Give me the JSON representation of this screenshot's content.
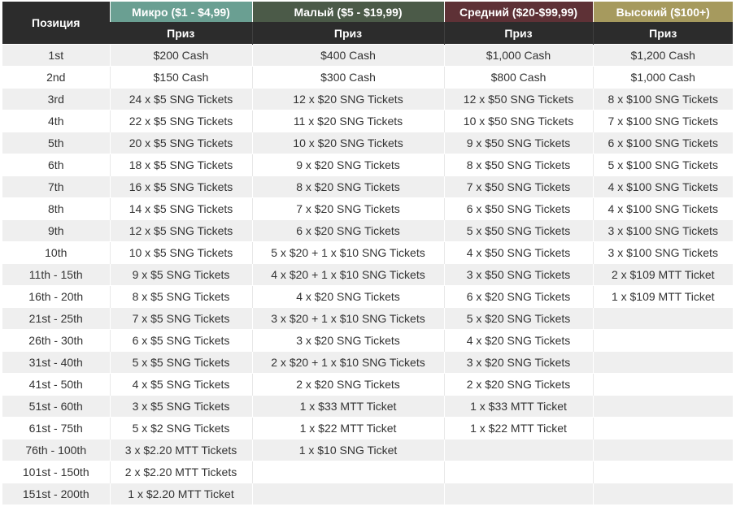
{
  "table": {
    "position_header": "Позиция",
    "prize_label": "Приз",
    "tiers": [
      {
        "label": "Микро ($1 - $4,99)",
        "color": "#6a9f92"
      },
      {
        "label": "Малый ($5 - $19,99)",
        "color": "#4b5a48"
      },
      {
        "label": "Средний ($20-$99,99)",
        "color": "#5e3136"
      },
      {
        "label": "Высокий ($100+)",
        "color": "#a69a5e"
      }
    ],
    "rows": [
      [
        "1st",
        "$200 Cash",
        "$400 Cash",
        "$1,000 Cash",
        "$1,200 Cash"
      ],
      [
        "2nd",
        "$150 Cash",
        "$300 Cash",
        "$800 Cash",
        "$1,000 Cash"
      ],
      [
        "3rd",
        "24 x $5 SNG Tickets",
        "12 x $20 SNG Tickets",
        "12 x $50 SNG Tickets",
        "8 x $100 SNG Tickets"
      ],
      [
        "4th",
        "22 x $5 SNG Tickets",
        "11 x $20 SNG Tickets",
        "10 x $50 SNG Tickets",
        "7 x $100 SNG Tickets"
      ],
      [
        "5th",
        "20 x $5 SNG Tickets",
        "10 x $20 SNG Tickets",
        "9 x $50 SNG Tickets",
        "6 x $100 SNG Tickets"
      ],
      [
        "6th",
        "18 x $5 SNG Tickets",
        "9 x $20 SNG Tickets",
        "8 x $50 SNG Tickets",
        "5 x $100 SNG Tickets"
      ],
      [
        "7th",
        "16 x $5 SNG Tickets",
        "8 x $20 SNG Tickets",
        "7 x $50 SNG Tickets",
        "4 x $100 SNG Tickets"
      ],
      [
        "8th",
        "14 x $5 SNG Tickets",
        "7 x $20 SNG Tickets",
        "6 x $50 SNG Tickets",
        "4 x $100 SNG Tickets"
      ],
      [
        "9th",
        "12 x $5 SNG Tickets",
        "6 x $20 SNG Tickets",
        "5 x $50 SNG Tickets",
        "3 x $100 SNG Tickets"
      ],
      [
        "10th",
        "10 x $5 SNG Tickets",
        "5 x $20 + 1 x $10 SNG Tickets",
        "4 x $50 SNG Tickets",
        "3 x $100 SNG Tickets"
      ],
      [
        "11th - 15th",
        "9 x $5 SNG Tickets",
        "4 x $20 + 1 x $10 SNG Tickets",
        "3 x $50 SNG Tickets",
        "2 x $109 MTT Ticket"
      ],
      [
        "16th - 20th",
        "8 x $5 SNG Tickets",
        "4 x $20 SNG Tickets",
        "6 x $20 SNG Tickets",
        "1 x $109 MTT Ticket"
      ],
      [
        "21st - 25th",
        "7 x $5 SNG Tickets",
        "3 x $20 + 1 x $10 SNG Tickets",
        "5 x $20 SNG Tickets",
        ""
      ],
      [
        "26th - 30th",
        "6 x $5 SNG Tickets",
        "3 x $20 SNG Tickets",
        "4 x $20 SNG Tickets",
        ""
      ],
      [
        "31st - 40th",
        "5 x $5 SNG Tickets",
        "2 x $20 + 1 x $10 SNG Tickets",
        "3 x $20 SNG Tickets",
        ""
      ],
      [
        "41st - 50th",
        "4 x $5 SNG Tickets",
        "2 x $20 SNG Tickets",
        "2 x $20 SNG Tickets",
        ""
      ],
      [
        "51st - 60th",
        "3 x $5 SNG Tickets",
        "1 x $33 MTT Ticket",
        "1 x $33 MTT Ticket",
        ""
      ],
      [
        "61st - 75th",
        "5 x $2 SNG Tickets",
        "1 x $22 MTT Ticket",
        "1 x $22 MTT Ticket",
        ""
      ],
      [
        "76th - 100th",
        "3 x $2.20 MTT Tickets",
        "1 x $10 SNG Ticket",
        "",
        ""
      ],
      [
        "101st - 150th",
        "2 x $2.20 MTT Tickets",
        "",
        "",
        ""
      ],
      [
        "151st - 200th",
        "1 x $2.20 MTT Ticket",
        "",
        "",
        ""
      ]
    ]
  }
}
